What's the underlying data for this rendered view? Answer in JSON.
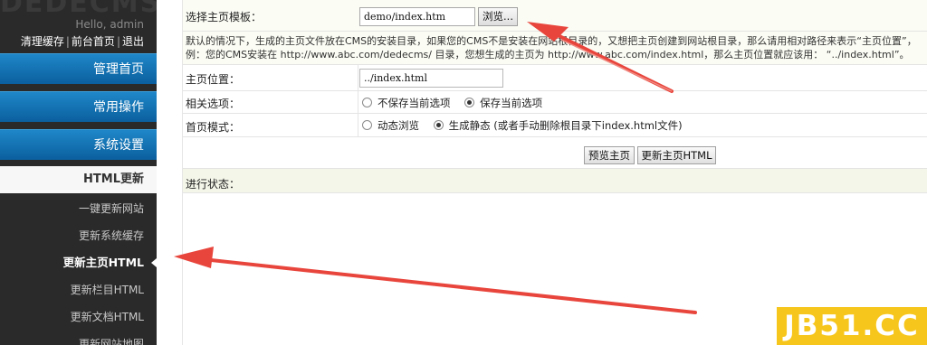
{
  "sidebar": {
    "logo_text": "DEDECMS",
    "hello": "Hello, admin",
    "links": [
      "清理缓存",
      "前台首页",
      "退出"
    ],
    "link_sep": "|",
    "menus": [
      "管理首页",
      "常用操作",
      "系统设置"
    ],
    "section_title": "HTML更新",
    "items": [
      "一键更新网站",
      "更新系统缓存",
      "更新主页HTML",
      "更新栏目HTML",
      "更新文档HTML",
      "更新网站地图"
    ],
    "active_item": "更新主页HTML"
  },
  "form": {
    "template_label": "选择主页模板：",
    "template_value": "demo/index.htm",
    "browse_label": "浏览...",
    "description_line1": "默认的情况下，生成的主页文件放在CMS的安装目录，如果您的CMS不是安装在网站根目录的，又想把主页创建到网站根目录，那么请用相对路径来表示“主页位置”，",
    "description_line2": "例：您的CMS安装在 http://www.abc.com/dedecms/ 目录，您想生成的主页为 http://www.abc.com/index.html，那么主页位置就应该用： “../index.html”。",
    "home_location_label": "主页位置：",
    "home_location_value": "../index.html",
    "related_label": "相关选项：",
    "related_options": [
      "不保存当前选项",
      "保存当前选项"
    ],
    "related_selected": "保存当前选项",
    "mode_label": "首页模式：",
    "mode_options": [
      "动态浏览",
      "生成静态 (或者手动删除根目录下index.html文件)"
    ],
    "mode_selected": "生成静态 (或者手动删除根目录下index.html文件)",
    "preview_label": "预览主页",
    "update_label": "更新主页HTML",
    "status_label": "进行状态："
  },
  "watermark": "JB51.CC",
  "colors": {
    "sidebar_bg": "#2a2a2a",
    "menu_blue": "#0b6fb0",
    "arrow_red": "#e8453c",
    "watermark_bg": "#f7c61c"
  }
}
